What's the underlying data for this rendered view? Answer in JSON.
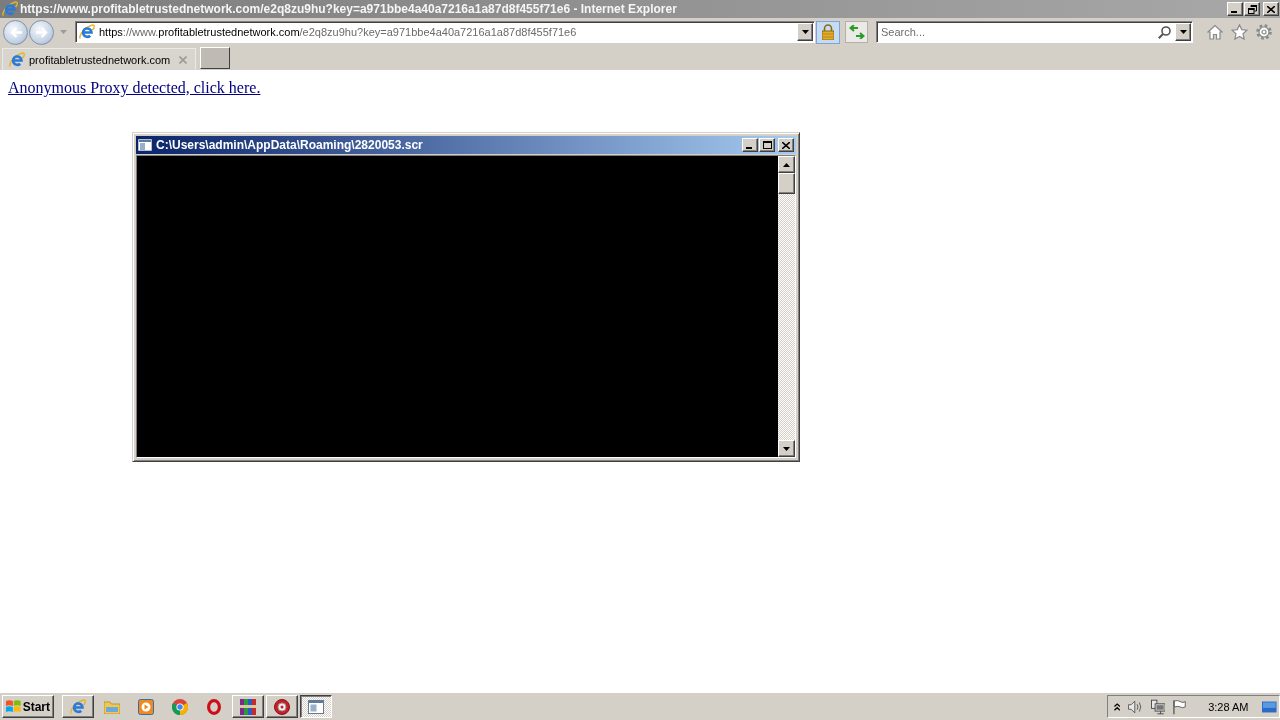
{
  "browser": {
    "title": "https://www.profitabletrustednetwork.com/e2q8zu9hu?key=a971bbe4a40a7216a1a87d8f455f71e6 - Internet Explorer",
    "address": {
      "segments": [
        {
          "text": "https",
          "emphasis": true
        },
        {
          "text": "://www.",
          "emphasis": false
        },
        {
          "text": "profitabletrustednetwork.com",
          "emphasis": true
        },
        {
          "text": "/e2q8zu9hu?key=a971bbe4a40a7216a1a87d8f455f71e6",
          "emphasis": false
        }
      ]
    },
    "search": {
      "placeholder": "Search..."
    },
    "tabs": [
      {
        "label": "profitabletrustednetwork.com",
        "selected": true
      }
    ]
  },
  "page": {
    "link": "Anonymous Proxy detected, click here."
  },
  "console_window": {
    "title": "C:\\Users\\admin\\AppData\\Roaming\\2820053.scr"
  },
  "taskbar": {
    "start": "Start",
    "apps": [
      {
        "kind": "e_browser",
        "open": true,
        "selected": false
      },
      {
        "kind": "folder",
        "open": false,
        "selected": false
      },
      {
        "kind": "player",
        "open": false,
        "selected": false
      },
      {
        "kind": "wheel",
        "open": false,
        "selected": false
      },
      {
        "kind": "ring",
        "open": false,
        "selected": false
      },
      {
        "kind": "archive",
        "open": true,
        "selected": false
      },
      {
        "kind": "disc",
        "open": true,
        "selected": false
      },
      {
        "kind": "console",
        "open": true,
        "selected": true
      }
    ],
    "clock": "3:28 AM"
  }
}
